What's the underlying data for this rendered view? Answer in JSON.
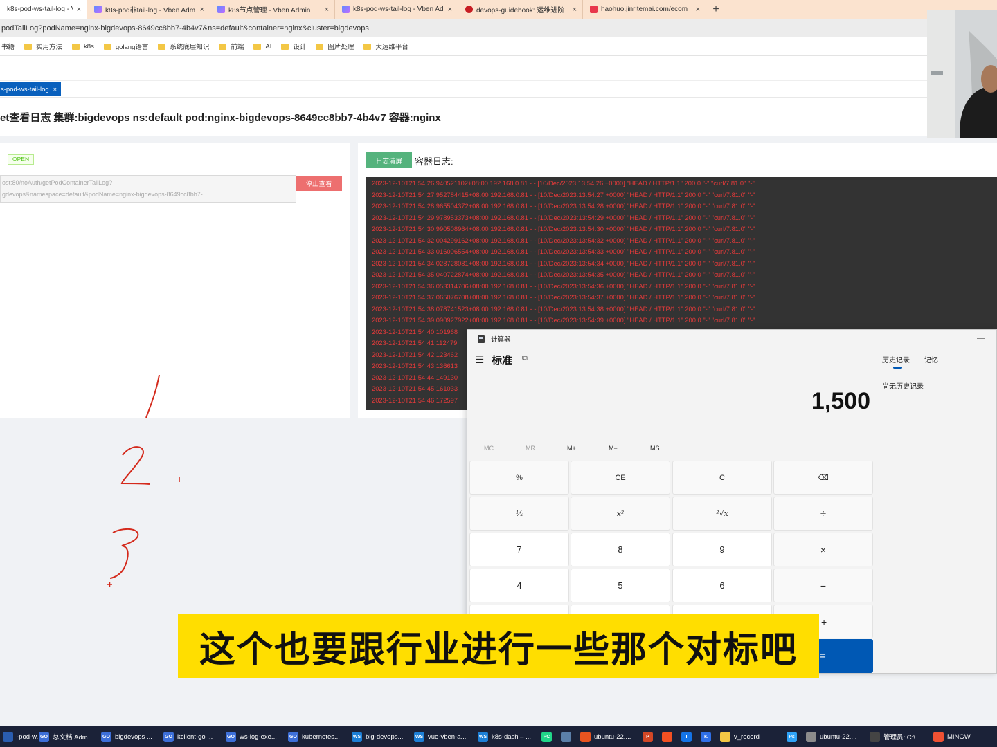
{
  "browser": {
    "tabs": [
      {
        "label": "k8s-pod-ws-tail-log - Vben Ad",
        "favicon": "vben",
        "close": "×",
        "active": true
      },
      {
        "label": "k8s-pod非tail-log - Vben Adm",
        "favicon": "vben",
        "close": "×",
        "active": false
      },
      {
        "label": "k8s节点管理 - Vben Admin",
        "favicon": "vben",
        "close": "×",
        "active": false
      },
      {
        "label": "k8s-pod-ws-tail-log - Vben Ad",
        "favicon": "vben",
        "close": "×",
        "active": false
      },
      {
        "label": "devops-guidebook: 运维进阶",
        "favicon": "gitee",
        "close": "×",
        "active": false
      },
      {
        "label": "haohuo.jinritemai.com/ecom",
        "favicon": "douyin",
        "close": "×",
        "active": false
      }
    ],
    "new_tab": "+",
    "address": "podTailLog?podName=nginx-bigdevops-8649cc8bb7-4b4v7&ns=default&container=nginx&cluster=bigdevops",
    "bookmarks": [
      "书籍",
      "实用方法",
      "k8s",
      "golang语言",
      "系统底层知识",
      "前端",
      "AI",
      "设计",
      "图片处理",
      "大运维平台"
    ]
  },
  "app": {
    "active_tab": "s-pod-ws-tail-log",
    "active_tab_close": "×",
    "heading": "et查看日志 集群:bigdevops ns:default pod:nginx-bigdevops-8649cc8bb7-4b4v7 容器:nginx",
    "ws_status": "OPEN",
    "ws_url_line1": "ost:80/noAuth/getPodContainerTailLog?",
    "ws_url_line2": "gdevops&namespace=default&podName=nginx-bigdevops-8649cc8bb7-",
    "stop_button": "停止查看",
    "clear_button": "日志清屏",
    "log_label": "容器日志:",
    "log_lines": [
      "2023-12-10T21:54:26.940521102+08:00 192.168.0.81 - - [10/Dec/2023:13:54:26 +0000] \"HEAD / HTTP/1.1\" 200 0 \"-\" \"curl/7.81.0\" \"-\"",
      "2023-12-10T21:54:27.952784415+08:00 192.168.0.81 - - [10/Dec/2023:13:54:27 +0000] \"HEAD / HTTP/1.1\" 200 0 \"-\" \"curl/7.81.0\" \"-\"",
      "2023-12-10T21:54:28.965504372+08:00 192.168.0.81 - - [10/Dec/2023:13:54:28 +0000] \"HEAD / HTTP/1.1\" 200 0 \"-\" \"curl/7.81.0\" \"-\"",
      "2023-12-10T21:54:29.978953373+08:00 192.168.0.81 - - [10/Dec/2023:13:54:29 +0000] \"HEAD / HTTP/1.1\" 200 0 \"-\" \"curl/7.81.0\" \"-\"",
      "2023-12-10T21:54:30.990508964+08:00 192.168.0.81 - - [10/Dec/2023:13:54:30 +0000] \"HEAD / HTTP/1.1\" 200 0 \"-\" \"curl/7.81.0\" \"-\"",
      "2023-12-10T21:54:32.004299162+08:00 192.168.0.81 - - [10/Dec/2023:13:54:32 +0000] \"HEAD / HTTP/1.1\" 200 0 \"-\" \"curl/7.81.0\" \"-\"",
      "2023-12-10T21:54:33.016006554+08:00 192.168.0.81 - - [10/Dec/2023:13:54:33 +0000] \"HEAD / HTTP/1.1\" 200 0 \"-\" \"curl/7.81.0\" \"-\"",
      "2023-12-10T21:54:34.028728081+08:00 192.168.0.81 - - [10/Dec/2023:13:54:34 +0000] \"HEAD / HTTP/1.1\" 200 0 \"-\" \"curl/7.81.0\" \"-\"",
      "2023-12-10T21:54:35.040722874+08:00 192.168.0.81 - - [10/Dec/2023:13:54:35 +0000] \"HEAD / HTTP/1.1\" 200 0 \"-\" \"curl/7.81.0\" \"-\"",
      "2023-12-10T21:54:36.053314706+08:00 192.168.0.81 - - [10/Dec/2023:13:54:36 +0000] \"HEAD / HTTP/1.1\" 200 0 \"-\" \"curl/7.81.0\" \"-\"",
      "2023-12-10T21:54:37.065076708+08:00 192.168.0.81 - - [10/Dec/2023:13:54:37 +0000] \"HEAD / HTTP/1.1\" 200 0 \"-\" \"curl/7.81.0\" \"-\"",
      "2023-12-10T21:54:38.078741523+08:00 192.168.0.81 - - [10/Dec/2023:13:54:38 +0000] \"HEAD / HTTP/1.1\" 200 0 \"-\" \"curl/7.81.0\" \"-\"",
      "2023-12-10T21:54:39.090927922+08:00 192.168.0.81 - - [10/Dec/2023:13:54:39 +0000] \"HEAD / HTTP/1.1\" 200 0 \"-\" \"curl/7.81.0\" \"-\"",
      "2023-12-10T21:54:40.101968",
      "2023-12-10T21:54:41.112479",
      "2023-12-10T21:54:42.123462",
      "2023-12-10T21:54:43.136613",
      "2023-12-10T21:54:44.149130",
      "2023-12-10T21:54:45.161033",
      "2023-12-10T21:54:46.172597"
    ]
  },
  "handwriting": {
    "marks": [
      "1",
      "2",
      "3"
    ],
    "color": "#d42a1c"
  },
  "calculator": {
    "title": "计算器",
    "minimize": "—",
    "menu_icon": "☰",
    "mode": "标准",
    "keep_on_top_icon": "⧉",
    "display": "1,500",
    "memory": [
      {
        "label": "MC",
        "enabled": false
      },
      {
        "label": "MR",
        "enabled": false
      },
      {
        "label": "M+",
        "enabled": true
      },
      {
        "label": "M−",
        "enabled": true
      },
      {
        "label": "MS",
        "enabled": true
      }
    ],
    "keys": {
      "percent": "%",
      "ce": "CE",
      "clear": "C",
      "backspace": "⌫",
      "reciprocal": "¹⁄ₓ",
      "square": "x²",
      "sqrt": "²√x",
      "divide": "÷",
      "n7": "7",
      "n8": "8",
      "n9": "9",
      "multiply": "×",
      "n4": "4",
      "n5": "5",
      "n6": "6",
      "minus": "−",
      "plus": "+",
      "equals": "="
    },
    "history_tab": "历史记录",
    "memory_tab": "记忆",
    "history_empty": "尚无历史记录",
    "accent": "#0058b4"
  },
  "subtitle": "这个也要跟行业进行一些那个对标吧",
  "taskbar": {
    "items": [
      {
        "label": "-pod-w...",
        "icon": "ws-icon",
        "color": "#2a5db0",
        "glyph": ""
      },
      {
        "label": "总文档 Adm...",
        "icon": "goland-icon",
        "color": "#3d6fd8",
        "glyph": "GO"
      },
      {
        "label": "bigdevops ...",
        "icon": "goland-icon",
        "color": "#3d6fd8",
        "glyph": "GO"
      },
      {
        "label": "kclient-go ...",
        "icon": "goland-icon",
        "color": "#3d6fd8",
        "glyph": "GO"
      },
      {
        "label": "ws-log-exe...",
        "icon": "goland-icon",
        "color": "#3d6fd8",
        "glyph": "GO"
      },
      {
        "label": "kubernetes...",
        "icon": "goland-icon",
        "color": "#3d6fd8",
        "glyph": "GO"
      },
      {
        "label": "big-devops...",
        "icon": "webstorm-icon",
        "color": "#1c7fd6",
        "glyph": "WS"
      },
      {
        "label": "vue-vben-a...",
        "icon": "webstorm-icon",
        "color": "#1c7fd6",
        "glyph": "WS"
      },
      {
        "label": "k8s-dash – ...",
        "icon": "webstorm-icon",
        "color": "#1c7fd6",
        "glyph": "WS"
      },
      {
        "label": "",
        "icon": "pycharm-icon",
        "color": "#21d789",
        "glyph": "PC"
      },
      {
        "label": "",
        "icon": "screen-icon",
        "color": "#5b7fa8",
        "glyph": ""
      },
      {
        "label": "ubuntu-22....",
        "icon": "ubuntu-icon",
        "color": "#e95420",
        "glyph": ""
      },
      {
        "label": "",
        "icon": "powerpoint-icon",
        "color": "#d24726",
        "glyph": "P"
      },
      {
        "label": "",
        "icon": "windows-icon",
        "color": "#f25022",
        "glyph": ""
      },
      {
        "label": "",
        "icon": "typora-icon",
        "color": "#1473e6",
        "glyph": "T"
      },
      {
        "label": "",
        "icon": "kdocs-icon",
        "color": "#2f6fe8",
        "glyph": "K"
      },
      {
        "label": "v_record",
        "icon": "folder-icon",
        "color": "#f3c745",
        "glyph": ""
      },
      {
        "label": "",
        "icon": "photoshop-icon",
        "color": "#2fa3f7",
        "glyph": "Ps"
      },
      {
        "label": "ubuntu-22....",
        "icon": "vmware-icon",
        "color": "#8c8c8c",
        "glyph": ""
      },
      {
        "label": "管理员: C:\\...",
        "icon": "terminal-icon",
        "color": "#444",
        "glyph": ""
      },
      {
        "label": "MINGW",
        "icon": "git-bash-icon",
        "color": "#f05133",
        "glyph": ""
      }
    ]
  }
}
